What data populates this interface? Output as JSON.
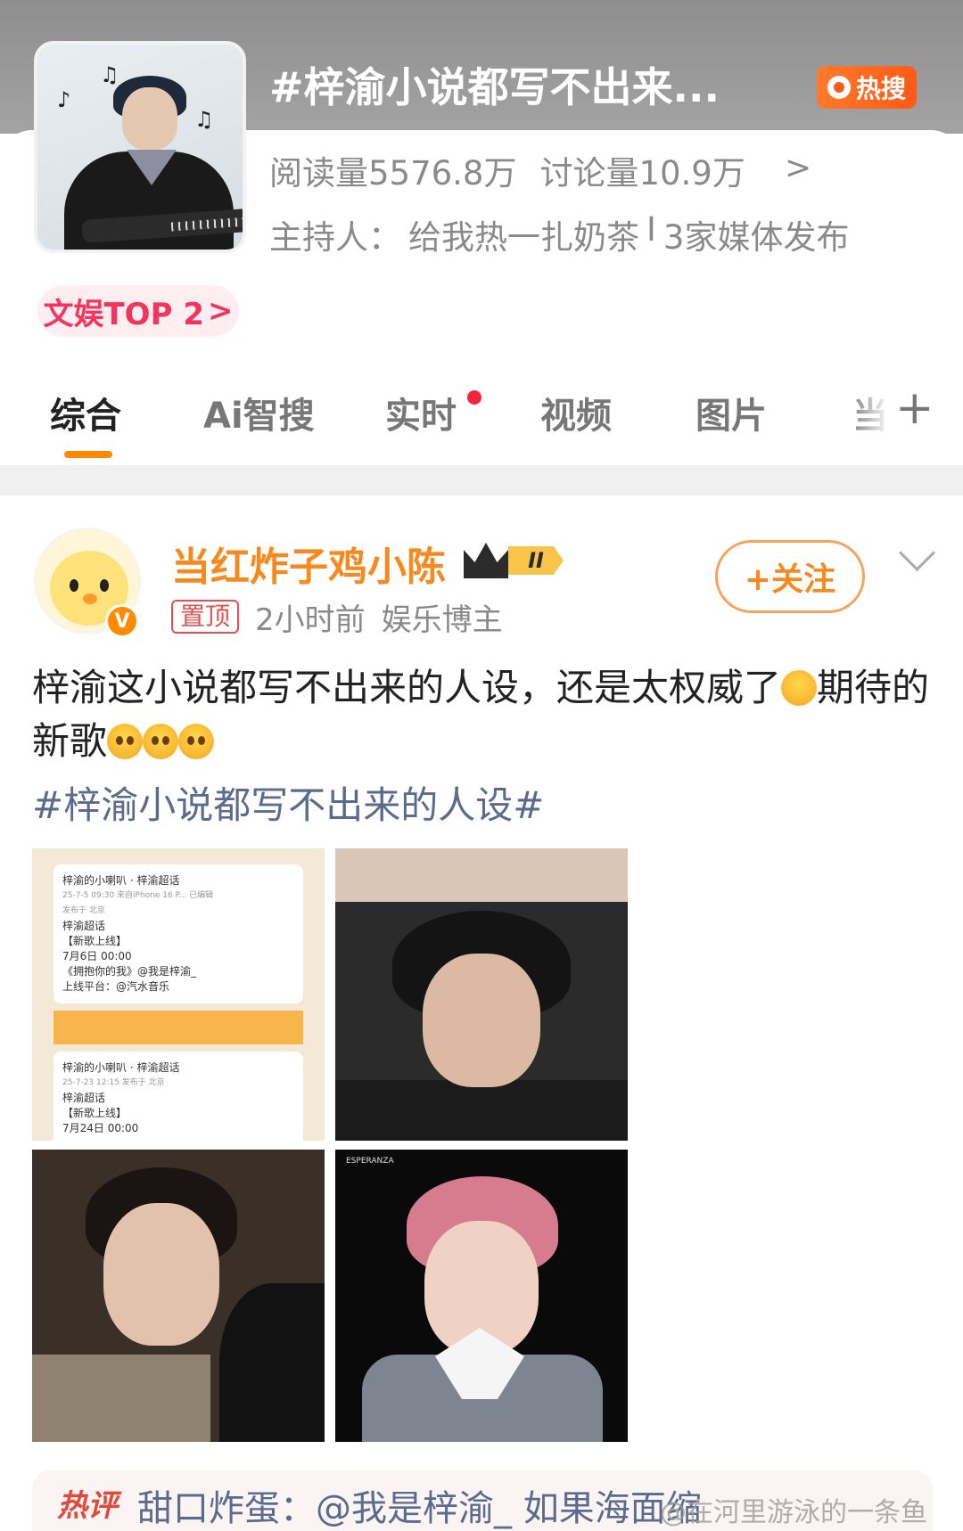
{
  "topic": {
    "title": "#梓渝小说都写不出来...",
    "hot_badge": "热搜",
    "reads": "阅读量5576.8万",
    "discussions": "讨论量10.9万",
    "host_label": "主持人：",
    "host_name": "给我热一扎奶茶",
    "host_sep": "I",
    "media_count": "3家媒体发布",
    "rank": "文娱TOP 2",
    "rank_chevron": ">",
    "stats_chevron": ">",
    "hot_color": "#ff5a17"
  },
  "tabs": [
    {
      "label": "综合",
      "active": true
    },
    {
      "label": "Ai智搜",
      "active": false
    },
    {
      "label": "实时",
      "active": false,
      "dot": true
    },
    {
      "label": "视频",
      "active": false
    },
    {
      "label": "图片",
      "active": false
    },
    {
      "label": "当",
      "active": false
    }
  ],
  "tab_add": "+",
  "post": {
    "username": "当红炸子鸡小陈",
    "level": "II",
    "pin": "置顶",
    "time": "2小时前",
    "role": "娱乐博主",
    "follow_label": "+关注",
    "text_part1": "梓渝这小说都写不出来的人设，还是太权威了",
    "text_part2": "期待的新歌",
    "hashtag": "#梓渝小说都写不出来的人设#",
    "verify_mark": "V",
    "name_color": "#f68a1e"
  },
  "image1": {
    "card1": {
      "author": "梓渝的小喇叭",
      "super": "梓渝超话",
      "meta": "25-7-5 09:30  来自iPhone 16 P...  已编辑",
      "loc": "发布于 北京",
      "tag": "梓渝超话",
      "title": "【新歌上线】",
      "date": "7月6日 00:00",
      "song": "《拥抱你的我》@我是梓渝_",
      "platform": "上线平台：@汽水音乐"
    },
    "card2": {
      "author": "梓渝的小喇叭",
      "super": "梓渝超话",
      "meta": "25-7-23 12:15  发布于 北京",
      "tag": "梓渝超话",
      "title": "【新歌上线】",
      "date": "7月24日 00:00"
    }
  },
  "image4": {
    "caption": "ESPERANZA"
  },
  "comment": {
    "label": "热评",
    "text": "甜口炸蛋：@我是梓渝_ 如果海面缩"
  },
  "watermark": "@在河里游泳的一条鱼"
}
